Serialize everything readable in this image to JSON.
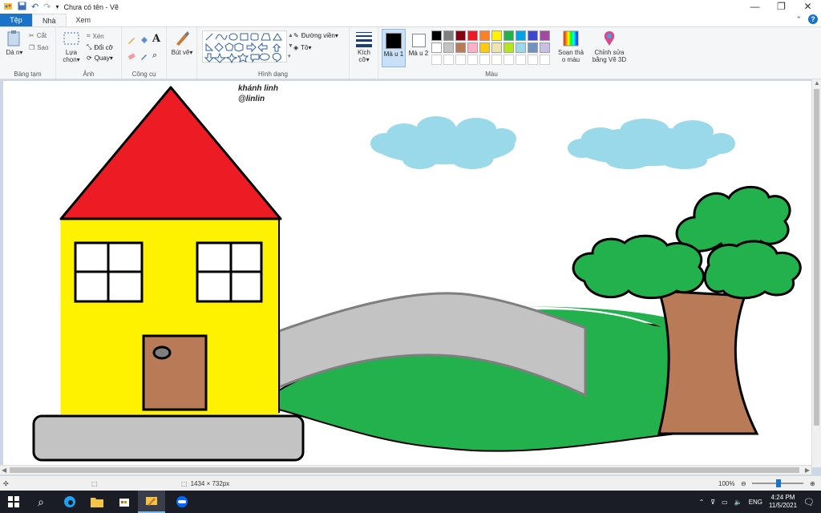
{
  "window": {
    "title": "Chưa có tên - Vẽ",
    "controls": {
      "minimize": "—",
      "maximize": "❐",
      "close": "✕"
    }
  },
  "tabs": [
    {
      "label": "Tệp"
    },
    {
      "label": "Nhà"
    },
    {
      "label": "Xem"
    }
  ],
  "ribbon": {
    "clipboard": {
      "paste": "Dá n▾",
      "cut": "Cắt",
      "copy": "Sao",
      "group": "Bảng tạm"
    },
    "image": {
      "select": "Lựa chọn▾",
      "crop": "Xén",
      "resize": "Đổi cỡ",
      "rotate": "Quay▾",
      "group": "Ảnh"
    },
    "tools": {
      "group": "Công cụ"
    },
    "brushes": {
      "label": "Bút vẽ▾"
    },
    "shapes": {
      "outline": "Đường viền▾",
      "fill": "Tô▾",
      "group": "Hình dạng"
    },
    "size": {
      "label": "Kích cỡ▾"
    },
    "color1": {
      "label": "Mà u 1"
    },
    "color2": {
      "label": "Mà u 2"
    },
    "colors_group": "Màu",
    "edit_colors": "Soạn thả o màu",
    "paint3d": "Chỉnh sửa bằng Vẽ 3D",
    "palette": [
      "#000000",
      "#7f7f7f",
      "#880015",
      "#ed1c24",
      "#ff7f27",
      "#fff200",
      "#22b14c",
      "#00a2e8",
      "#3f48cc",
      "#a349a4",
      "#ffffff",
      "#c3c3c3",
      "#b97a57",
      "#ffaec9",
      "#ffc90e",
      "#efe4b0",
      "#b5e61d",
      "#99d9ea",
      "#7092be",
      "#c8bfe7",
      "#ffffff",
      "#ffffff",
      "#ffffff",
      "#ffffff",
      "#ffffff",
      "#ffffff",
      "#ffffff",
      "#ffffff",
      "#ffffff",
      "#ffffff"
    ]
  },
  "drawing": {
    "caption_line1": "khánh linh",
    "caption_line2": "@linlin"
  },
  "status": {
    "canvas_size": "1434 × 732px",
    "zoom": "100%"
  },
  "taskbar": {
    "lang": "ENG",
    "time": "4:24 PM",
    "date": "11/5/2021"
  }
}
